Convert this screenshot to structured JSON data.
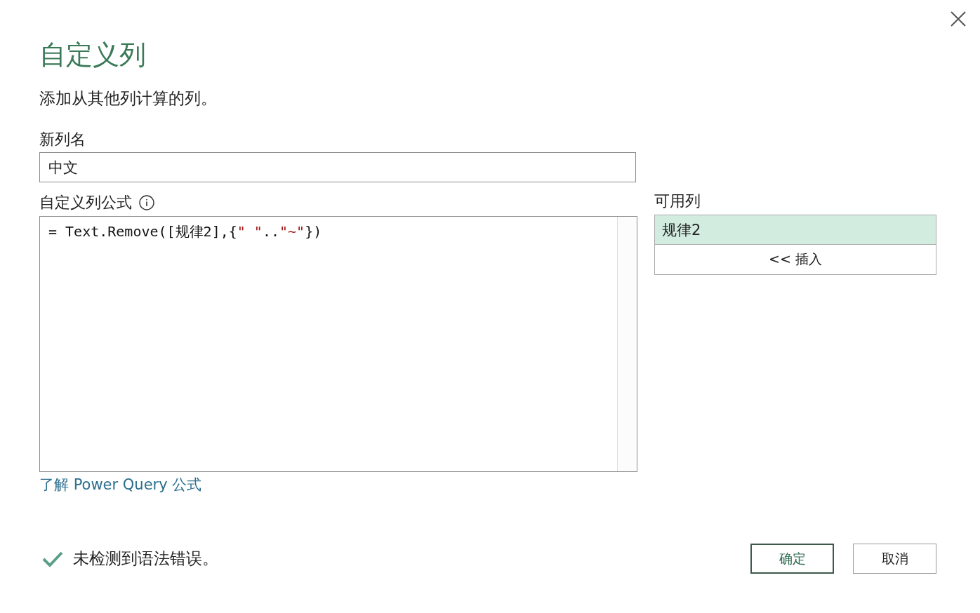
{
  "dialog": {
    "title": "自定义列",
    "subtitle": "添加从其他列计算的列。"
  },
  "new_column": {
    "label": "新列名",
    "value": "中文"
  },
  "formula": {
    "label": "自定义列公式",
    "tokens": [
      {
        "text": "= Text.Remove([规律2],{",
        "kind": "code"
      },
      {
        "text": "\" \"",
        "kind": "string"
      },
      {
        "text": "..",
        "kind": "code"
      },
      {
        "text": "\"~\"",
        "kind": "string"
      },
      {
        "text": "})",
        "kind": "code"
      }
    ]
  },
  "learn_link": "了解 Power Query 公式",
  "available_columns": {
    "label": "可用列",
    "items": [
      {
        "label": "规律2",
        "selected": true
      }
    ],
    "insert_button": "<< 插入"
  },
  "status": {
    "ok": true,
    "text": "未检测到语法错误。"
  },
  "buttons": [
    {
      "label": "确定",
      "default": true
    },
    {
      "label": "取消",
      "default": false
    }
  ]
}
